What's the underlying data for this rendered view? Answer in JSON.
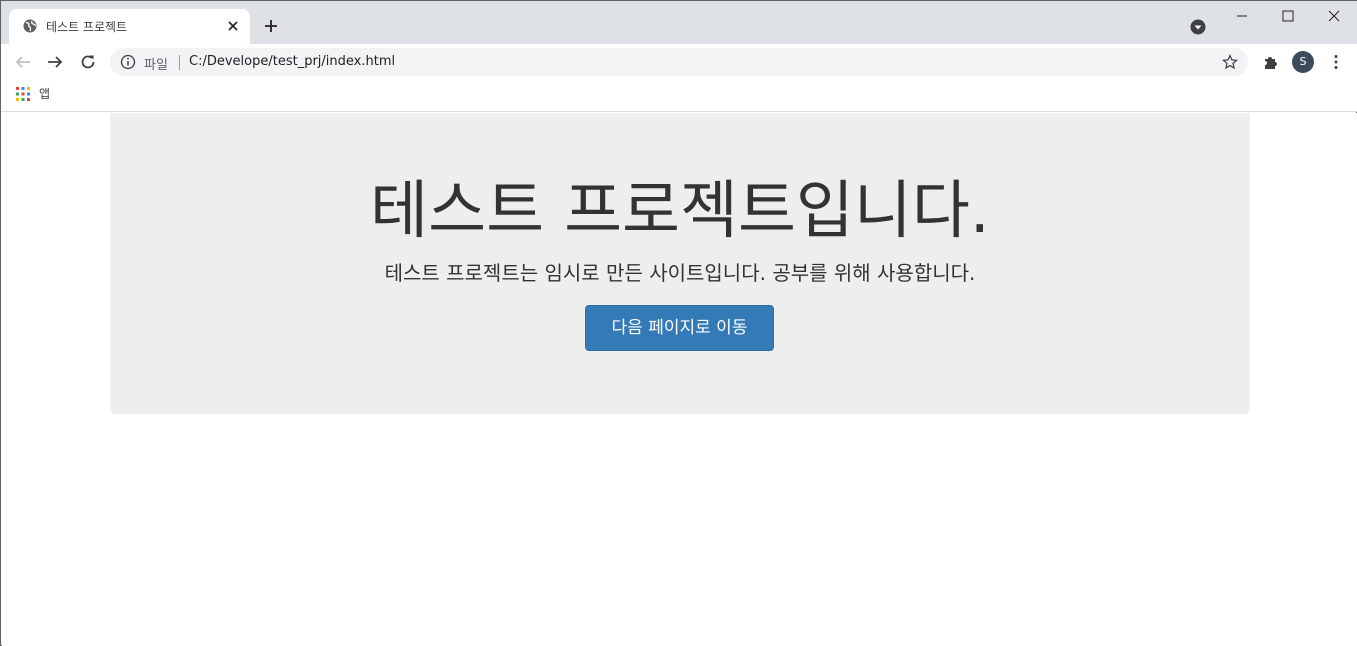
{
  "browser": {
    "tab": {
      "title": "테스트 프로젝트",
      "favicon": "globe-icon"
    },
    "window_controls": [
      "minimize-icon",
      "maximize-icon",
      "close-icon"
    ],
    "omnibox": {
      "chip": "파일",
      "url": "C:/Develope/test_prj/index.html"
    },
    "profile": {
      "initial": "S"
    },
    "bookmarks": {
      "apps_label": "앱"
    }
  },
  "page": {
    "heading": "테스트 프로젝트입니다.",
    "lead": "테스트 프로젝트는 임시로 만든 사이트입니다. 공부를 위해 사용합니다.",
    "button_label": "다음 페이지로 이동"
  },
  "colors": {
    "tabstrip": "#dee1e6",
    "jumbotron": "#eeeeee",
    "primary_button": "#337ab7",
    "text": "#333333"
  }
}
